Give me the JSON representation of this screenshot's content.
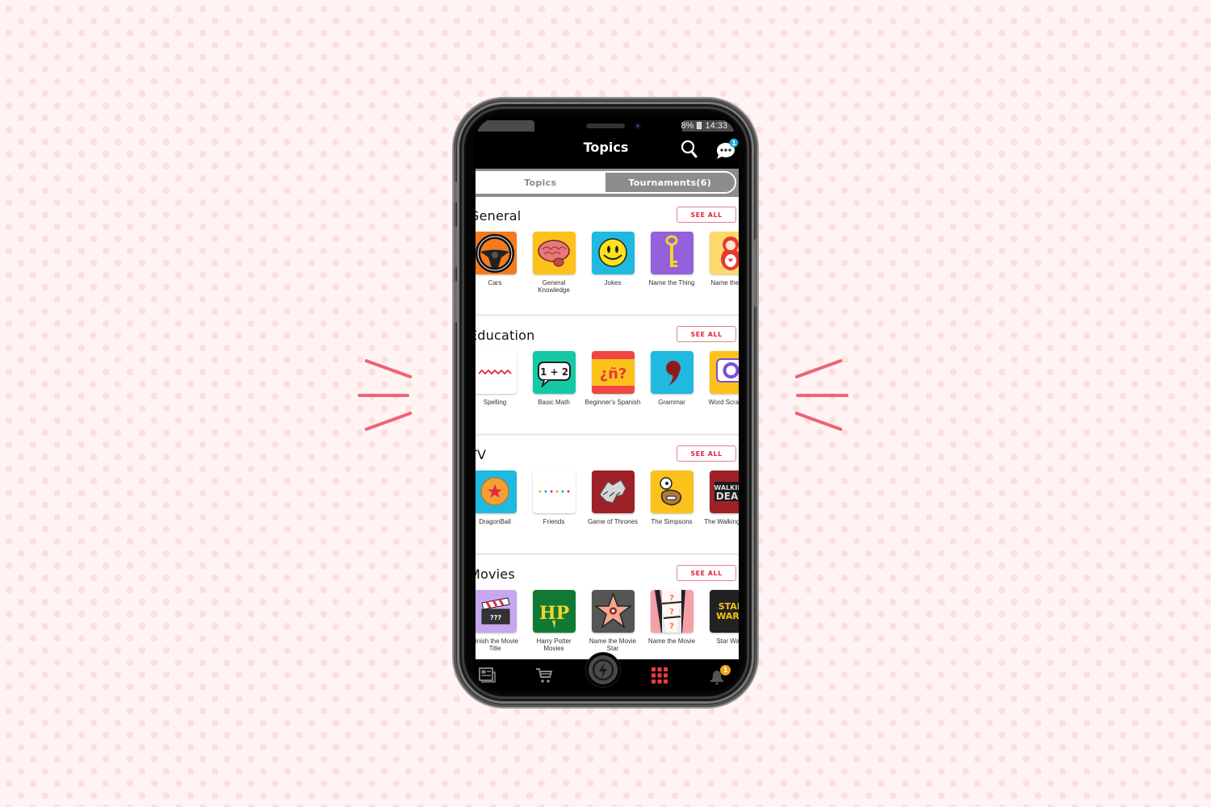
{
  "colors": {
    "accent": "#e22a3a",
    "background": "#fff4f3",
    "sparkle": "#ee6472"
  },
  "status_bar": {
    "battery": "8%",
    "time": "14:33"
  },
  "header": {
    "title": "Topics",
    "search_icon": "search-icon",
    "chat_icon": "chat-bubble-icon",
    "chat_badge": "1"
  },
  "tabs": [
    {
      "label": "Topics",
      "active": false
    },
    {
      "label": "Tournaments(6)",
      "active": true
    }
  ],
  "see_all_label": "SEE ALL",
  "sections": [
    {
      "title": "General",
      "items": [
        {
          "label": "Cars",
          "icon": "steering-wheel-icon",
          "bg": "#f47a20"
        },
        {
          "label": "General Knowledge",
          "icon": "brain-icon",
          "bg": "#fcc21b"
        },
        {
          "label": "Jokes",
          "icon": "smiley-icon",
          "bg": "#20b9e0"
        },
        {
          "label": "Name the Thing",
          "icon": "key-icon",
          "bg": "#9461dd"
        },
        {
          "label": "Name the Toy",
          "icon": "matryoshka-icon",
          "bg": "#fcd96a"
        }
      ]
    },
    {
      "title": "Education",
      "items": [
        {
          "label": "Spelling",
          "icon": "squiggle-icon",
          "bg": "#ffffff"
        },
        {
          "label": "Basic Math",
          "icon": "math-bubble-icon",
          "bg": "#16c9a6",
          "text": "1 + 2"
        },
        {
          "label": "Beginner's Spanish",
          "icon": "spanish-flag-icon",
          "bg": "#fcc21b",
          "text": "¿ñ?"
        },
        {
          "label": "Grammar",
          "icon": "comma-icon",
          "bg": "#20b9e0"
        },
        {
          "label": "Word Scramble",
          "icon": "scramble-icon",
          "bg": "#fcc21b"
        }
      ]
    },
    {
      "title": "TV",
      "items": [
        {
          "label": "DragonBall",
          "icon": "dragon-ball-icon",
          "bg": "#20b9e0"
        },
        {
          "label": "Friends",
          "icon": "friends-dots-icon",
          "bg": "#ffffff"
        },
        {
          "label": "Game of Thrones",
          "icon": "direwolf-icon",
          "bg": "#9e2128"
        },
        {
          "label": "The Simpsons",
          "icon": "homer-icon",
          "bg": "#fcc21b"
        },
        {
          "label": "The Walking Dead",
          "icon": "walking-dead-icon",
          "bg": "#9e2128",
          "text": "WALKING DEAD"
        }
      ]
    },
    {
      "title": "Movies",
      "items": [
        {
          "label": "Finish the Movie Title",
          "icon": "clapperboard-icon",
          "bg": "#c7a8ef",
          "text": "???"
        },
        {
          "label": "Harry Potter Movies",
          "icon": "hp-logo-icon",
          "bg": "#107a34",
          "text": "HP"
        },
        {
          "label": "Name the Movie Star",
          "icon": "walk-of-fame-star-icon",
          "bg": "#555555"
        },
        {
          "label": "Name the Movie",
          "icon": "film-strip-icon",
          "bg": "#f5a0a8",
          "text": "?"
        },
        {
          "label": "Star Wars",
          "icon": "star-wars-logo-icon",
          "bg": "#222222",
          "text": "STAR WARS"
        }
      ]
    }
  ],
  "bottom_nav": [
    {
      "icon": "news-icon",
      "active": false
    },
    {
      "icon": "cart-icon",
      "active": false
    },
    {
      "icon": "lightning-icon",
      "active": false
    },
    {
      "icon": "grid-icon",
      "active": true
    },
    {
      "icon": "bell-icon",
      "active": false,
      "badge": "1"
    }
  ]
}
